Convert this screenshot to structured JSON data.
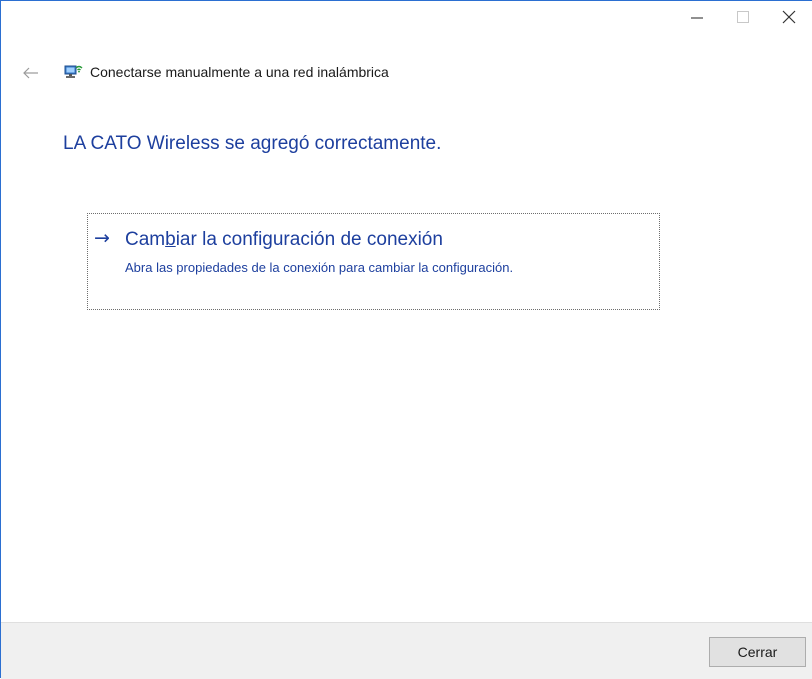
{
  "window": {
    "caption_buttons": {
      "minimize_icon": "minimize-icon",
      "maximize_icon": "maximize-icon",
      "close_icon": "close-icon"
    }
  },
  "header": {
    "back_icon": "back-arrow-icon",
    "network_icon": "wireless-network-icon",
    "title": "Conectarse manualmente a una red inalámbrica"
  },
  "main": {
    "heading": "LA CATO Wireless se agregó correctamente.",
    "command_link": {
      "arrow": "→",
      "title_before": "Cam",
      "title_mnemonic": "b",
      "title_after": "iar la configuración de conexión",
      "description": "Abra las propiedades de la conexión para cambiar la configuración."
    }
  },
  "footer": {
    "close_label": "Cerrar"
  },
  "colors": {
    "accent_blue": "#1d3f9e",
    "footer_bg": "#f0f0f0",
    "window_border": "#2b6fd1"
  }
}
